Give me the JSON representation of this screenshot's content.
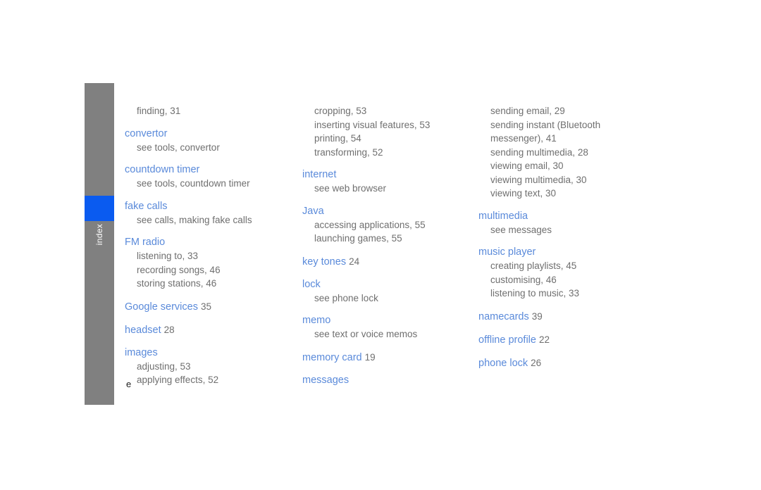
{
  "page": {
    "marker": "e",
    "accent_blue": "#5a8ada",
    "tab_gray": "#808080",
    "tab_highlight_blue": "#0a5bf0",
    "body_gray": "#6f6f6f"
  },
  "side_tab": {
    "label": "index"
  },
  "columns": [
    {
      "name": "left",
      "entries": [
        {
          "kind": "orphan",
          "subs": [
            "finding,  31"
          ]
        },
        {
          "kind": "entry",
          "heading": "convertor",
          "pagenum": "",
          "subs": [
            "see tools, convertor"
          ]
        },
        {
          "kind": "entry",
          "heading": "countdown timer",
          "pagenum": "",
          "subs": [
            "see tools, countdown timer"
          ]
        },
        {
          "kind": "entry",
          "heading": "fake calls",
          "pagenum": "",
          "subs": [
            "see calls, making fake calls"
          ]
        },
        {
          "kind": "entry",
          "heading": "FM radio",
          "pagenum": "",
          "subs": [
            "listening to,  33",
            "recording songs,  46",
            "storing stations,  46"
          ]
        },
        {
          "kind": "entry",
          "heading": "Google services",
          "pagenum": "35",
          "subs": []
        },
        {
          "kind": "entry",
          "heading": "headset",
          "pagenum": "28",
          "subs": []
        },
        {
          "kind": "entry",
          "heading": "images",
          "pagenum": "",
          "subs": [
            "adjusting,  53",
            "applying effects,  52"
          ]
        }
      ]
    },
    {
      "name": "middle",
      "entries": [
        {
          "kind": "orphan",
          "subs": [
            "cropping,  53",
            "inserting visual features,  53",
            "printing,  54",
            "transforming,  52"
          ]
        },
        {
          "kind": "entry",
          "heading": "internet",
          "pagenum": "",
          "subs": [
            "see web browser"
          ]
        },
        {
          "kind": "entry",
          "heading": "Java",
          "pagenum": "",
          "subs": [
            "accessing applications,  55",
            "launching games,  55"
          ]
        },
        {
          "kind": "entry",
          "heading": "key tones",
          "pagenum": "24",
          "subs": []
        },
        {
          "kind": "entry",
          "heading": "lock",
          "pagenum": "",
          "subs": [
            "see phone lock"
          ]
        },
        {
          "kind": "entry",
          "heading": "memo",
          "pagenum": "",
          "subs": [
            "see text or voice memos"
          ]
        },
        {
          "kind": "entry",
          "heading": "memory card",
          "pagenum": "19",
          "subs": []
        },
        {
          "kind": "entry",
          "heading": "messages",
          "pagenum": "",
          "subs": []
        }
      ]
    },
    {
      "name": "right",
      "entries": [
        {
          "kind": "orphan",
          "subs": [
            "sending email,  29",
            "sending instant (Bluetooth messenger),  41",
            "sending multimedia,  28",
            "viewing email,  30",
            "viewing multimedia,  30",
            "viewing text,  30"
          ]
        },
        {
          "kind": "entry",
          "heading": "multimedia",
          "pagenum": "",
          "subs": [
            "see messages"
          ]
        },
        {
          "kind": "entry",
          "heading": "music player",
          "pagenum": "",
          "subs": [
            "creating playlists,  45",
            "customising,  46",
            "listening to music,  33"
          ]
        },
        {
          "kind": "entry",
          "heading": "namecards",
          "pagenum": "39",
          "subs": []
        },
        {
          "kind": "entry",
          "heading": "offline profile",
          "pagenum": "22",
          "subs": []
        },
        {
          "kind": "entry",
          "heading": "phone lock",
          "pagenum": "26",
          "subs": []
        }
      ]
    }
  ]
}
